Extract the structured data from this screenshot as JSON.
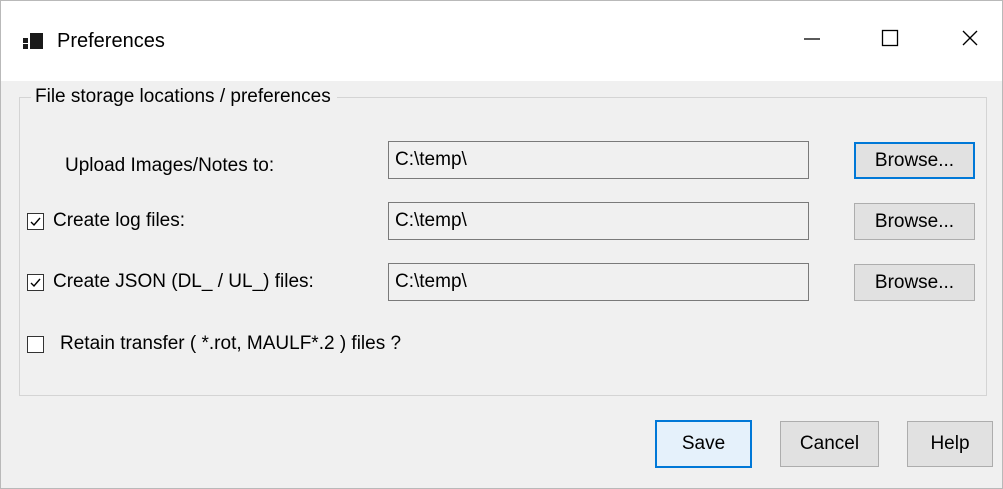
{
  "window": {
    "title": "Preferences",
    "icon": "app-window-icon",
    "controls": {
      "minimize": "minimize-icon",
      "maximize": "maximize-icon",
      "close": "close-icon"
    }
  },
  "group": {
    "label": "File storage locations / preferences"
  },
  "rows": {
    "upload": {
      "label": "Upload Images/Notes to:",
      "path": "C:\\temp\\",
      "browse_label": "Browse..."
    },
    "log": {
      "label": "Create log files:",
      "checked": true,
      "path": "C:\\temp\\",
      "browse_label": "Browse..."
    },
    "json": {
      "label": "Create JSON (DL_ / UL_) files:",
      "checked": true,
      "path": "C:\\temp\\",
      "browse_label": "Browse..."
    },
    "retain": {
      "label": "Retain transfer ( *.rot, MAULF*.2 ) files ?",
      "checked": false
    }
  },
  "footer": {
    "save_label": "Save",
    "cancel_label": "Cancel",
    "help_label": "Help"
  },
  "colors": {
    "accent": "#0078d7",
    "window_bg": "#f0f0f0",
    "button_bg": "#e1e1e1",
    "default_button_bg": "#e5f1fb"
  }
}
